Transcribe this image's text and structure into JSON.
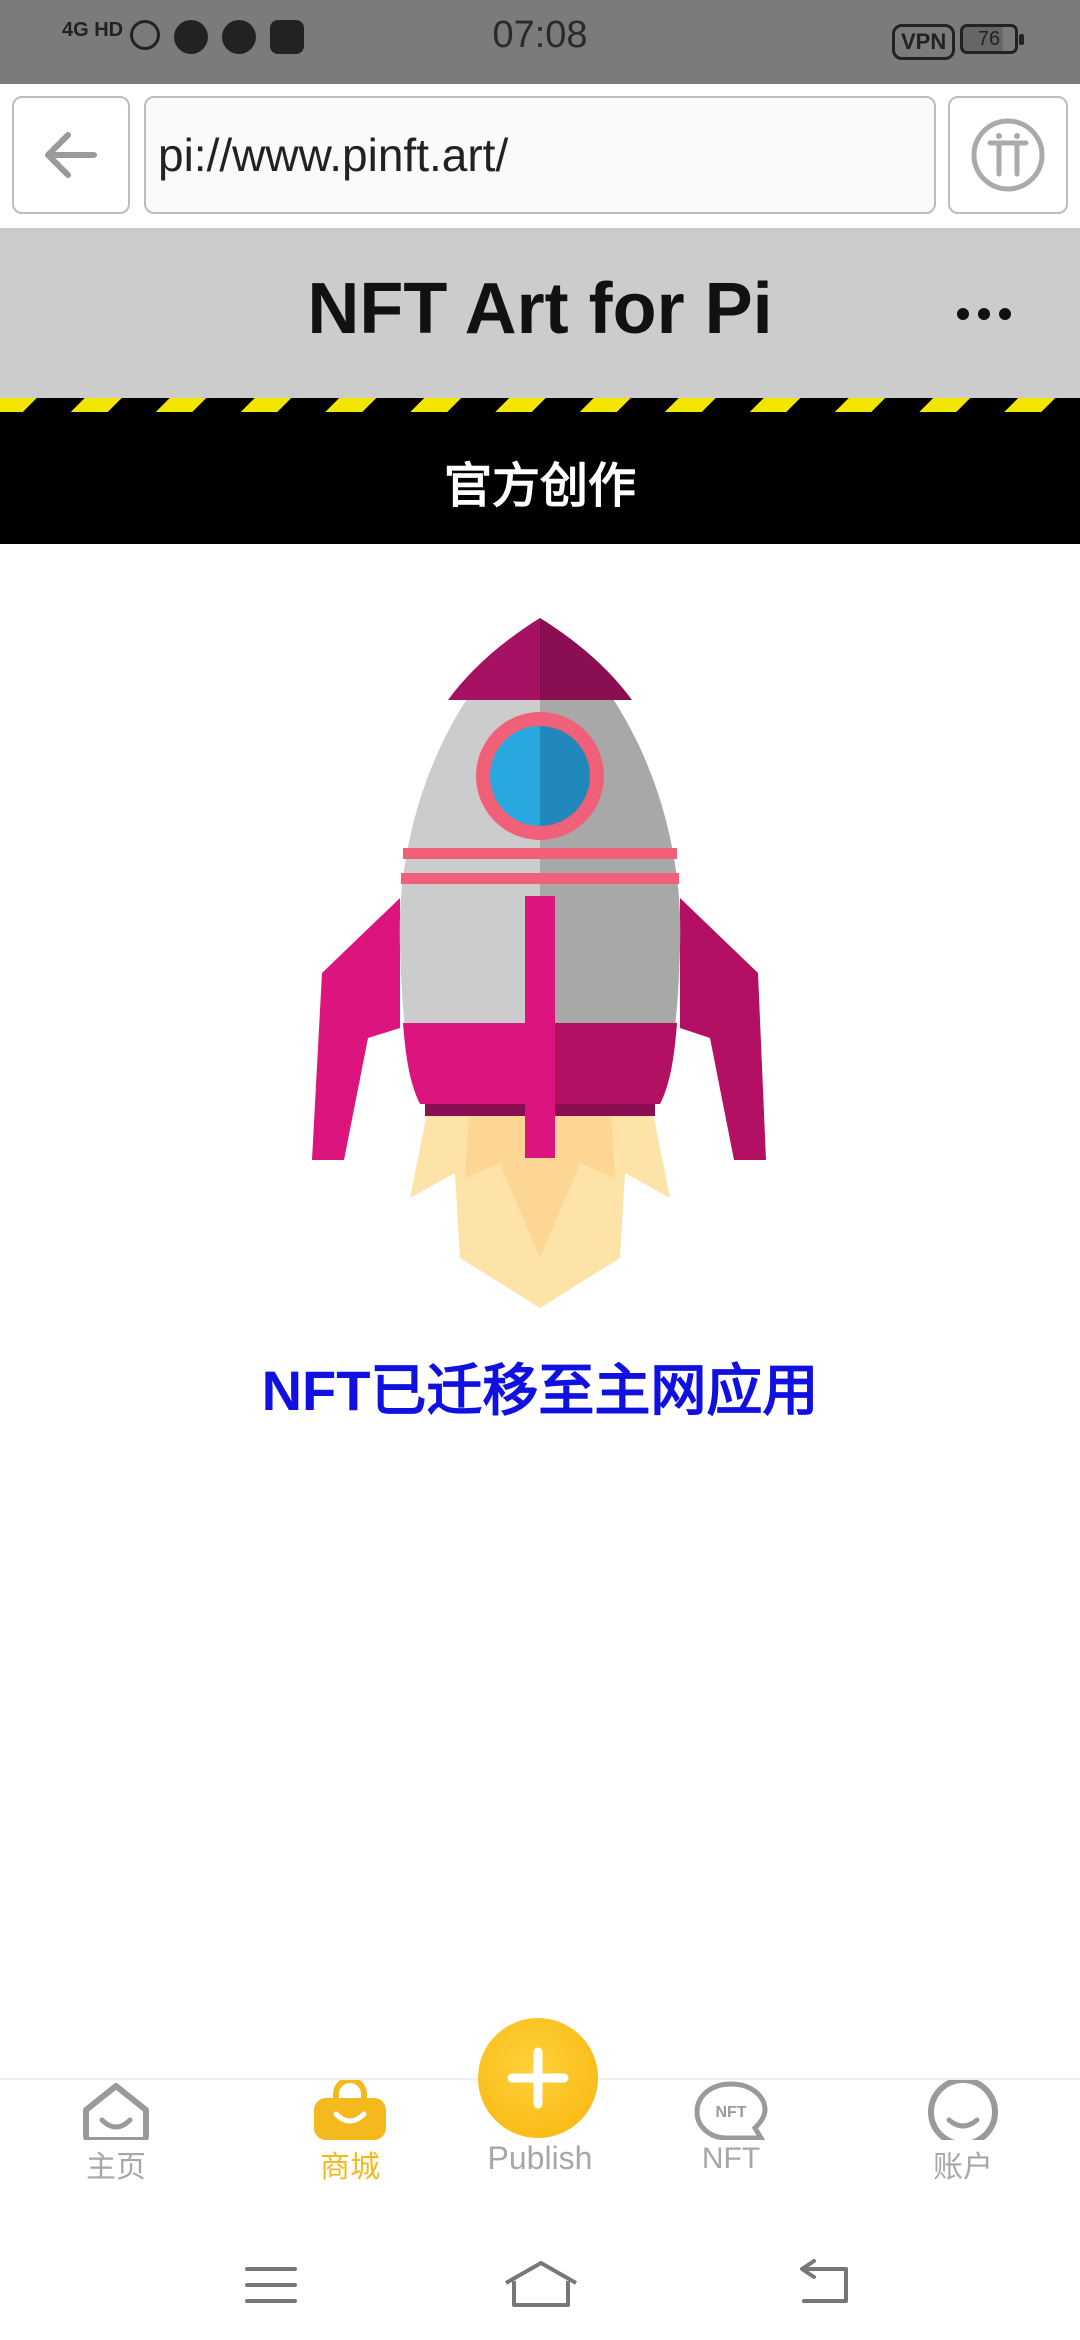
{
  "status_bar": {
    "time": "07:08",
    "network": "4G HD",
    "vpn": "VPN",
    "battery": "76"
  },
  "browser": {
    "url": "pi://www.pinft.art/",
    "back_icon": "arrow-left-icon",
    "pi_icon": "pi-logo-icon"
  },
  "header": {
    "title": "NFT Art for Pi",
    "more_icon": "more-horizontal-icon"
  },
  "section": {
    "label": "官方创作"
  },
  "main": {
    "illustration": "rocket-icon",
    "message": "NFT已迁移至主网应用"
  },
  "bottom_nav": {
    "items": [
      {
        "label": "主页",
        "icon": "home-icon"
      },
      {
        "label": "商城",
        "icon": "shopping-bag-icon"
      },
      {
        "label": "Publish",
        "icon": "plus-icon"
      },
      {
        "label": "NFT",
        "icon": "nft-icon"
      },
      {
        "label": "账户",
        "icon": "account-icon"
      }
    ],
    "active": "商城"
  },
  "colors": {
    "active": "#f4b91c",
    "inactive": "#a7a7a7",
    "message": "#1010e0",
    "hazard_yellow": "#f2e600"
  }
}
